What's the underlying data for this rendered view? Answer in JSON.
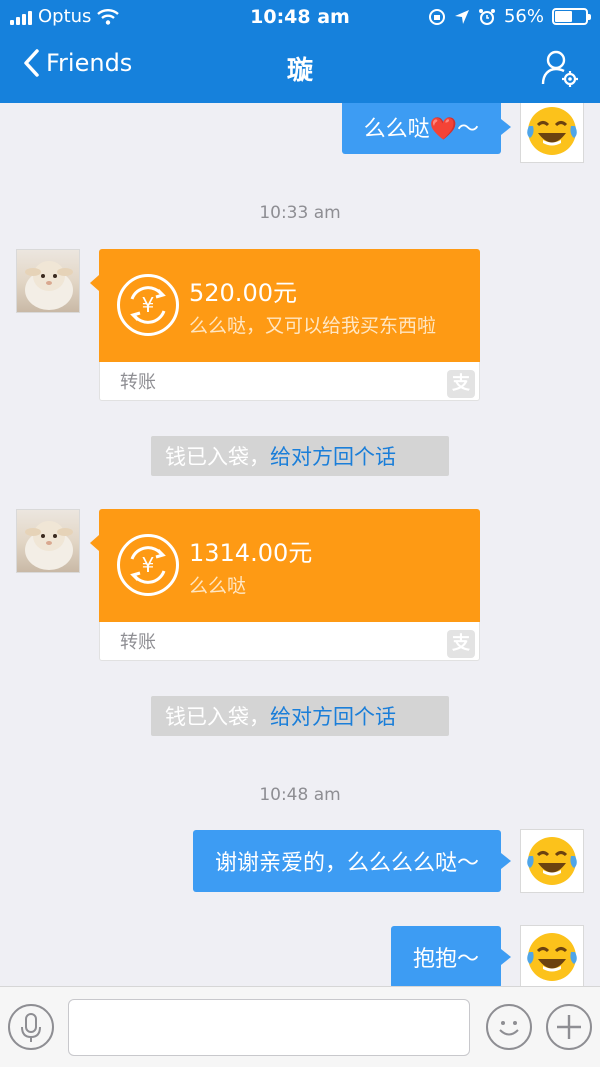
{
  "status_bar": {
    "carrier": "Optus",
    "time": "10:48 am",
    "battery_percent": "56%",
    "battery_level": 0.56
  },
  "nav": {
    "back_label": "Friends",
    "title": "璇"
  },
  "messages": {
    "m0": {
      "text": "么么哒❤️～"
    },
    "ts1": "10:33 am",
    "transfer1": {
      "amount": "520.00元",
      "note": "么么哒，又可以给我买东西啦",
      "label": "转账"
    },
    "sys1": {
      "text": "钱已入袋，",
      "link": "给对方回个话"
    },
    "transfer2": {
      "amount": "1314.00元",
      "note": "么么哒",
      "label": "转账"
    },
    "sys2": {
      "text": "钱已入袋，",
      "link": "给对方回个话"
    },
    "ts2": "10:48 am",
    "m1": {
      "text": "谢谢亲爱的，么么么么哒～"
    },
    "m2": {
      "text": "抱抱～"
    }
  },
  "icons": {
    "alipay_glyph": "支",
    "yuan_glyph": "¥"
  },
  "colors": {
    "nav_blue": "#1681dc",
    "bubble_blue": "#3d9cf3",
    "transfer_orange": "#fe9a14",
    "link_blue": "#1a7ed9"
  }
}
